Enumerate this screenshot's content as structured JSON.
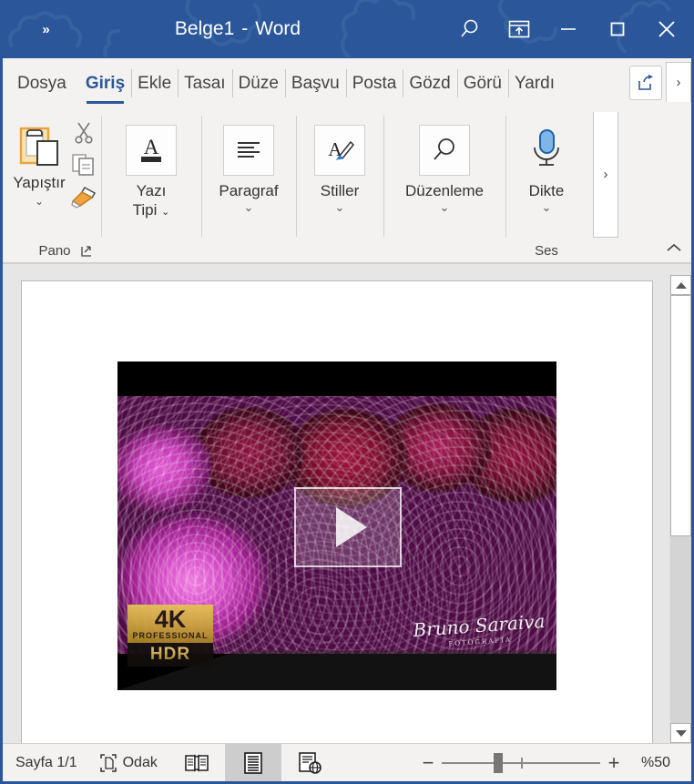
{
  "titlebar": {
    "qat_overflow": "»",
    "doc_name": "Belge1",
    "separator": "-",
    "app_name": "Word",
    "search_icon": "search-icon",
    "ribbon_options_icon": "ribbon-display-options-icon",
    "minimize_label": "—",
    "maximize_label": "□",
    "close_label": "✕",
    "bg_color": "#2b579a"
  },
  "tabs": [
    {
      "label": "Dosya",
      "active": false
    },
    {
      "label": "Giriş",
      "active": true
    },
    {
      "label": "Ekle",
      "active": false
    },
    {
      "label": "Tasaı",
      "active": false
    },
    {
      "label": "Düze",
      "active": false
    },
    {
      "label": "Başvu",
      "active": false
    },
    {
      "label": "Posta",
      "active": false
    },
    {
      "label": "Gözd",
      "active": false
    },
    {
      "label": "Görü",
      "active": false
    },
    {
      "label": "Yardı",
      "active": false
    }
  ],
  "tabbar": {
    "share_icon": "share-icon",
    "more_tabs_label": "›"
  },
  "ribbon": {
    "more_commands_label": "›",
    "collapse_label": "^",
    "groups": [
      {
        "name": "Pano",
        "label": "Pano",
        "paste_label": "Yapıştır",
        "paste_caret": "⌄",
        "dialog_launcher": "dialog-box-launcher",
        "items": [
          "paste-icon",
          "cut-icon",
          "copy-icon",
          "format-painter-icon"
        ]
      },
      {
        "name": "YaziTipi",
        "label": "Yazı",
        "label2": "Tipi",
        "caret": "⌄",
        "icon": "font-icon"
      },
      {
        "name": "Paragraf",
        "label": "Paragraf",
        "caret": "⌄",
        "icon": "paragraph-icon"
      },
      {
        "name": "Stiller",
        "label": "Stiller",
        "caret": "⌄",
        "icon": "styles-icon"
      },
      {
        "name": "Duzenleme",
        "label": "Düzenleme",
        "caret": "⌄",
        "icon": "editing-find-icon"
      },
      {
        "name": "Ses",
        "label": "Ses",
        "button_label": "Dikte",
        "caret": "⌄",
        "icon": "microphone-icon"
      }
    ]
  },
  "document": {
    "video": {
      "badge_4k": "4K",
      "badge_professional": "PROFESSIONAL",
      "badge_hdr": "HDR",
      "signature": "Bruno Saraiva",
      "signature_sub": "FOTOGRAFIA",
      "play_icon": "play-button-icon",
      "alt": "dahlia flowers video thumbnail"
    }
  },
  "statusbar": {
    "page_label": "Sayfa 1/1",
    "focus_label": "Odak",
    "focus_icon": "focus-mode-icon",
    "views": [
      {
        "name": "read-mode",
        "icon": "read-mode-icon",
        "active": false
      },
      {
        "name": "print-layout",
        "icon": "print-layout-icon",
        "active": true
      },
      {
        "name": "web-layout",
        "icon": "web-layout-icon",
        "active": false
      }
    ],
    "zoom_out": "−",
    "zoom_in": "+",
    "zoom_value": "%50",
    "zoom_percent": 50
  },
  "scrollbar": {
    "up_arrow": "scroll-up-arrow",
    "down_arrow": "scroll-down-arrow"
  }
}
